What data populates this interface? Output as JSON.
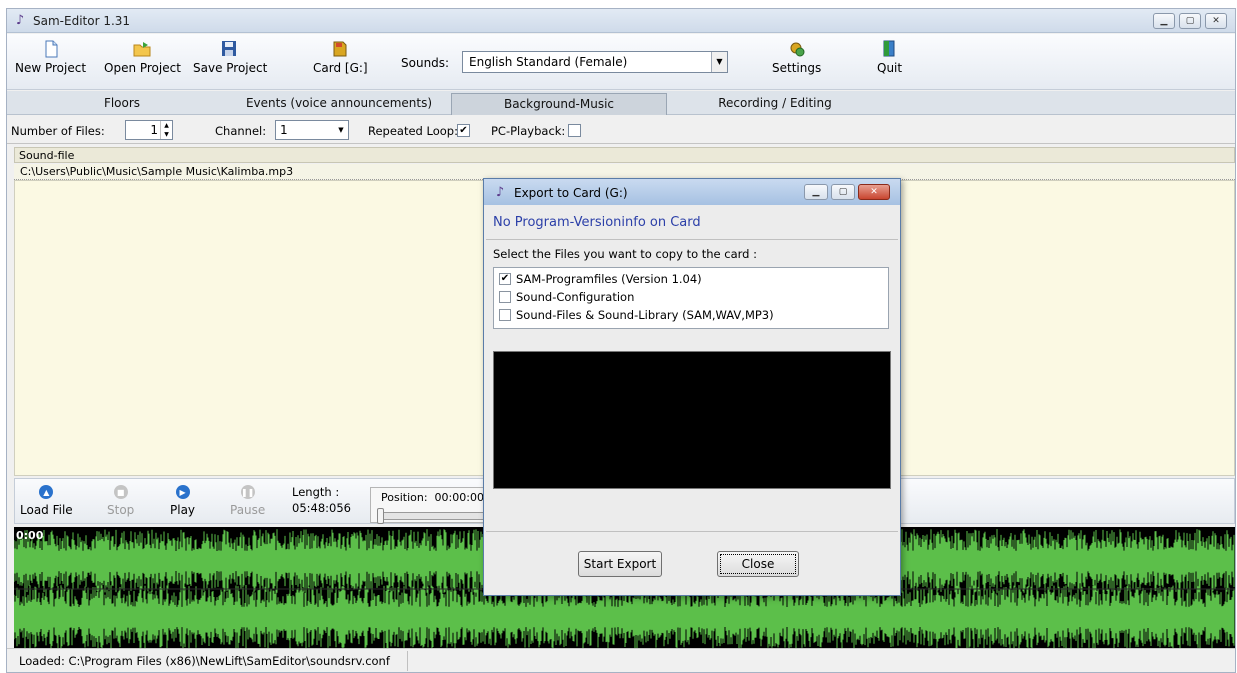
{
  "app": {
    "title": "Sam-Editor 1.31"
  },
  "toolbar": {
    "new_project": "New Project",
    "open_project": "Open Project",
    "save_project": "Save Project",
    "card": "Card [G:]",
    "sounds_label": "Sounds:",
    "sounds_value": "English Standard (Female)",
    "settings": "Settings",
    "quit": "Quit"
  },
  "tabs": [
    {
      "label": "Floors"
    },
    {
      "label": "Events  (voice announcements)"
    },
    {
      "label": "Background-Music",
      "active": true
    },
    {
      "label": "Recording / Editing"
    }
  ],
  "options": {
    "num_files_label": "Number of Files:",
    "num_files_value": "1",
    "channel_label": "Channel:",
    "channel_value": "1",
    "repeated_loop_label": "Repeated Loop:",
    "repeated_loop_checked": "✔",
    "pc_playback_label": "PC-Playback:"
  },
  "list": {
    "header": "Sound-file",
    "rows": [
      "C:\\Users\\Public\\Music\\Sample Music\\Kalimba.mp3"
    ]
  },
  "player": {
    "load": "Load File",
    "stop": "Stop",
    "play": "Play",
    "pause": "Pause",
    "length_label": "Length :",
    "length_value": "05:48:056",
    "position_label": "Position:",
    "position_value": "00:00:00"
  },
  "wave": {
    "position": "0:00",
    "color": "#5cbf4a"
  },
  "status": {
    "text": "Loaded:   C:\\Program Files (x86)\\NewLift\\SamEditor\\soundsrv.conf"
  },
  "dialog": {
    "title": "Export to Card (G:)",
    "note": "No Program-Versioninfo on Card",
    "select_label": "Select the Files you want to copy to the card :",
    "files": [
      {
        "label": "SAM-Programfiles (Version 1.04)",
        "mark": "✔"
      },
      {
        "label": "Sound-Configuration",
        "mark": ""
      },
      {
        "label": "Sound-Files & Sound-Library (SAM,WAV,MP3)",
        "mark": ""
      }
    ],
    "start_export": "Start Export",
    "close": "Close"
  }
}
